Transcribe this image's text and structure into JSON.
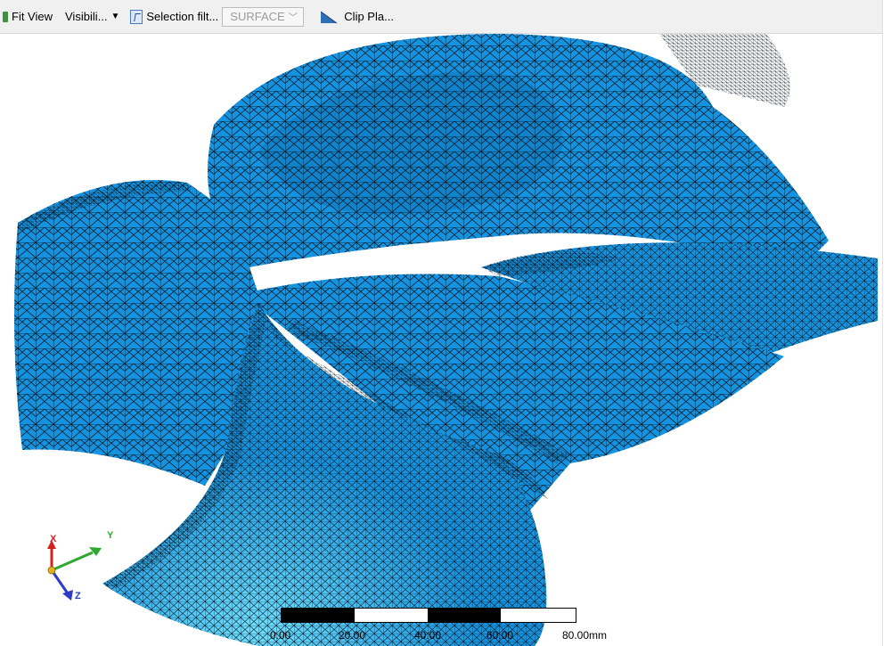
{
  "toolbar": {
    "fit_view": "Fit View",
    "visibility": "Visibili...",
    "selection_filter": "Selection filt...",
    "selection_value": "SURFACE",
    "clip_plane": "Clip Pla..."
  },
  "scale_bar": {
    "labels": [
      "0.00",
      "20.00",
      "40.00",
      "60.00",
      "80.00mm"
    ]
  },
  "triad": {
    "x_label": "X",
    "y_label": "Y",
    "z_label": "Z",
    "x_color": "#d42020",
    "y_color": "#2ea82e",
    "z_color": "#2a3cc8"
  },
  "mesh": {
    "surface_color": "#1493e0",
    "edge_color": "#0a1a28"
  }
}
